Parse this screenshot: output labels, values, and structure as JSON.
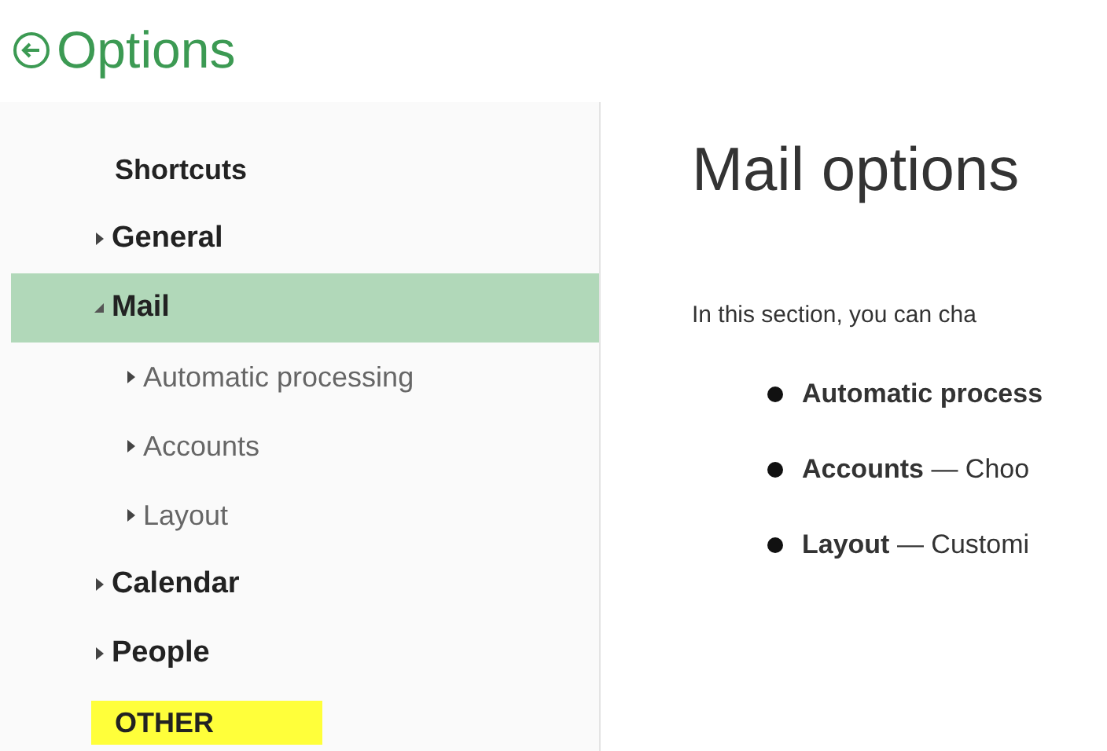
{
  "header": {
    "title": "Options"
  },
  "sidebar": {
    "items": [
      {
        "label": "Shortcuts",
        "kind": "heading",
        "highlighted": false
      },
      {
        "label": "General",
        "kind": "section",
        "expanded": false,
        "selected": false
      },
      {
        "label": "Mail",
        "kind": "section",
        "expanded": true,
        "selected": true,
        "children": [
          {
            "label": "Automatic processing",
            "expanded": false
          },
          {
            "label": "Accounts",
            "expanded": false
          },
          {
            "label": "Layout",
            "expanded": false
          }
        ]
      },
      {
        "label": "Calendar",
        "kind": "section",
        "expanded": false,
        "selected": false
      },
      {
        "label": "People",
        "kind": "section",
        "expanded": false,
        "selected": false
      },
      {
        "label": "OTHER",
        "kind": "heading",
        "highlighted": true
      }
    ]
  },
  "main": {
    "title": "Mail options",
    "intro": "In this section, you can cha",
    "bullets": [
      "**Automatic process**",
      "**Accounts** — Choo",
      "**Layout** — Customi"
    ]
  }
}
